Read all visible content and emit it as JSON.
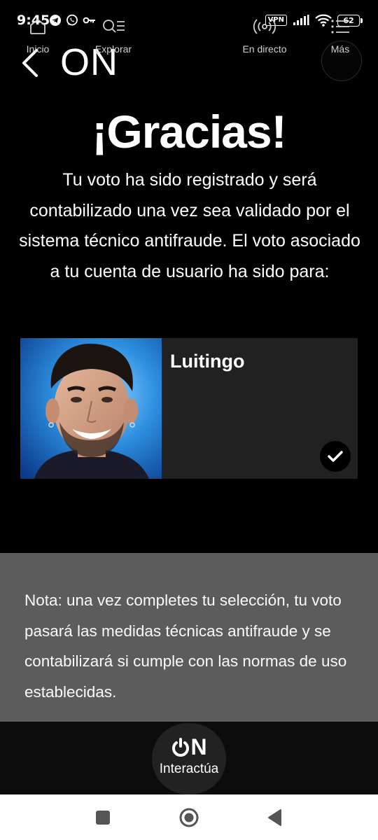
{
  "status_bar": {
    "time": "9:45",
    "left_icons": [
      "telegram-icon",
      "whatsapp-icon",
      "key-icon"
    ],
    "vpn": "VPN",
    "battery": "62"
  },
  "header": {
    "logo": "ON"
  },
  "main": {
    "title": "¡Gracias!",
    "message": "Tu voto ha sido registrado y será contabilizado una vez sea validado por el sistema técnico antifraude. El voto asociado a tu cuenta de usuario ha sido para:"
  },
  "candidate": {
    "name": "Luitingo",
    "selected": true
  },
  "note": {
    "text": "Nota: una vez completes tu selección, tu voto pasará las medidas técnicas antifraude y se contabilizará si cumple con las normas de uso establecidas."
  },
  "bottom_nav": {
    "items": [
      {
        "label": "Inicio",
        "icon": "home-icon"
      },
      {
        "label": "Explorar",
        "icon": "search-list-icon"
      },
      {
        "label": "Interactúa",
        "icon": "on-power-logo",
        "active": true
      },
      {
        "label": "En directo",
        "icon": "broadcast-icon"
      },
      {
        "label": "Más",
        "icon": "menu-list-icon"
      }
    ],
    "center_logo": "ON"
  },
  "colors": {
    "background": "#000000",
    "card": "#212121",
    "note_panel": "#5c5c5c",
    "nav_bar": "#0c0c0c"
  }
}
